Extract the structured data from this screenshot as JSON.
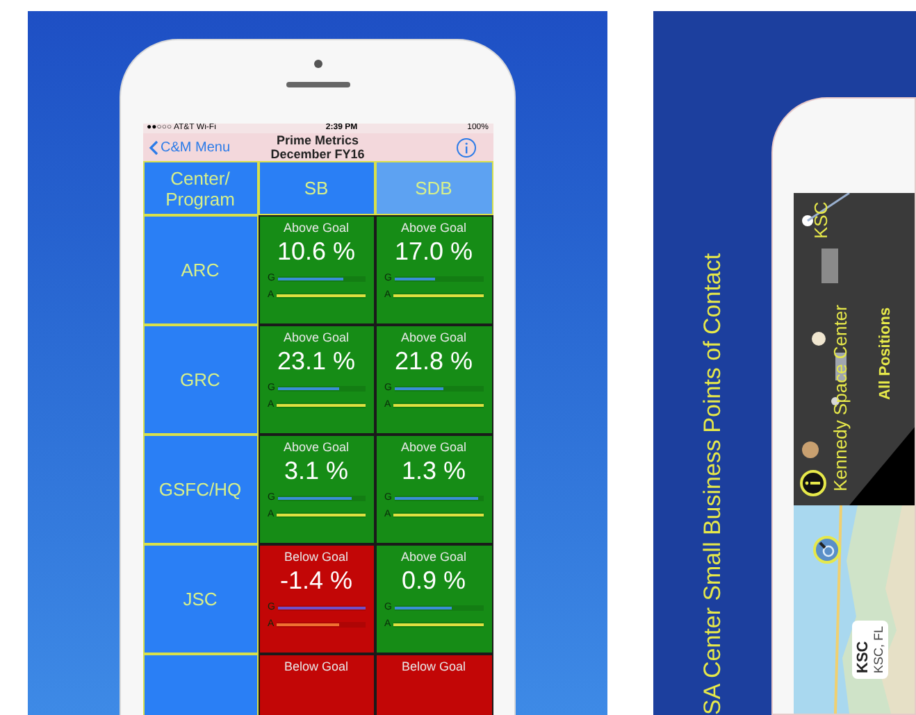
{
  "metrics_screen": {
    "status_bar": {
      "carrier": "●●○○○ AT&T Wi-Fi",
      "time": "2:39 PM",
      "battery": "100%"
    },
    "nav": {
      "back": "C&M Menu",
      "title": "Prime Metrics",
      "subtitle": "December FY16"
    },
    "columns": [
      {
        "label": "Center/ Program",
        "color": "#2a7ff5"
      },
      {
        "label": "SB",
        "color": "#2a7ff5"
      },
      {
        "label": "SDB",
        "color": "#5da2f2"
      }
    ],
    "rows": [
      {
        "cells": [
          {
            "kind": "center",
            "label": "ARC"
          },
          {
            "kind": "above",
            "label": "Above Goal",
            "value": "10.6 %",
            "bars": [
              {
                "label": "G",
                "level": 0.75,
                "color": "#3b8ed6"
              },
              {
                "label": "A",
                "level": 1,
                "color": "#e0e040"
              }
            ]
          },
          {
            "kind": "above",
            "label": "Above Goal",
            "value": "17.0 %",
            "bars": [
              {
                "label": "G",
                "level": 0.45,
                "color": "#3b8ed6"
              },
              {
                "label": "A",
                "level": 1,
                "color": "#e0e040"
              }
            ]
          }
        ]
      },
      {
        "cells": [
          {
            "kind": "center",
            "label": "GRC"
          },
          {
            "kind": "above",
            "label": "Above Goal",
            "value": "23.1 %",
            "bars": [
              {
                "label": "G",
                "level": 0.7,
                "color": "#3b8ed6"
              },
              {
                "label": "A",
                "level": 1,
                "color": "#e0e040"
              }
            ]
          },
          {
            "kind": "above",
            "label": "Above Goal",
            "value": "21.8 %",
            "bars": [
              {
                "label": "G",
                "level": 0.55,
                "color": "#3b8ed6"
              },
              {
                "label": "A",
                "level": 1,
                "color": "#e0e040"
              }
            ]
          }
        ]
      },
      {
        "cells": [
          {
            "kind": "center",
            "label": "GSFC/HQ"
          },
          {
            "kind": "above",
            "label": "Above Goal",
            "value": "3.1 %",
            "bars": [
              {
                "label": "G",
                "level": 0.85,
                "color": "#3b8ed6"
              },
              {
                "label": "A",
                "level": 1,
                "color": "#e0e040"
              }
            ]
          },
          {
            "kind": "above",
            "label": "Above Goal",
            "value": "1.3 %",
            "bars": [
              {
                "label": "G",
                "level": 0.95,
                "color": "#3b8ed6"
              },
              {
                "label": "A",
                "level": 1,
                "color": "#e0e040"
              }
            ]
          }
        ]
      },
      {
        "cells": [
          {
            "kind": "center",
            "label": "JSC"
          },
          {
            "kind": "below",
            "label": "Below Goal",
            "value": "-1.4 %",
            "bars": [
              {
                "label": "G",
                "level": 1,
                "color": "#7050c8"
              },
              {
                "label": "A",
                "level": 0.7,
                "color": "#f07030"
              }
            ]
          },
          {
            "kind": "above",
            "label": "Above Goal",
            "value": "0.9 %",
            "bars": [
              {
                "label": "G",
                "level": 0.65,
                "color": "#3b8ed6"
              },
              {
                "label": "A",
                "level": 1,
                "color": "#e0e040"
              }
            ]
          }
        ]
      },
      {
        "cells": [
          {
            "kind": "center"
          },
          {
            "kind": "below",
            "label": "Below Goal"
          },
          {
            "kind": "below",
            "label": "Below Goal"
          }
        ]
      }
    ]
  },
  "contacts_screen": {
    "title": "SA Center Small Business Points of Contact",
    "header": {
      "code": "KSC",
      "name": "Kennedy Space Center",
      "filter": "All Positions"
    },
    "callout": {
      "title": "KSC",
      "subtitle": "KSC, FL"
    }
  }
}
